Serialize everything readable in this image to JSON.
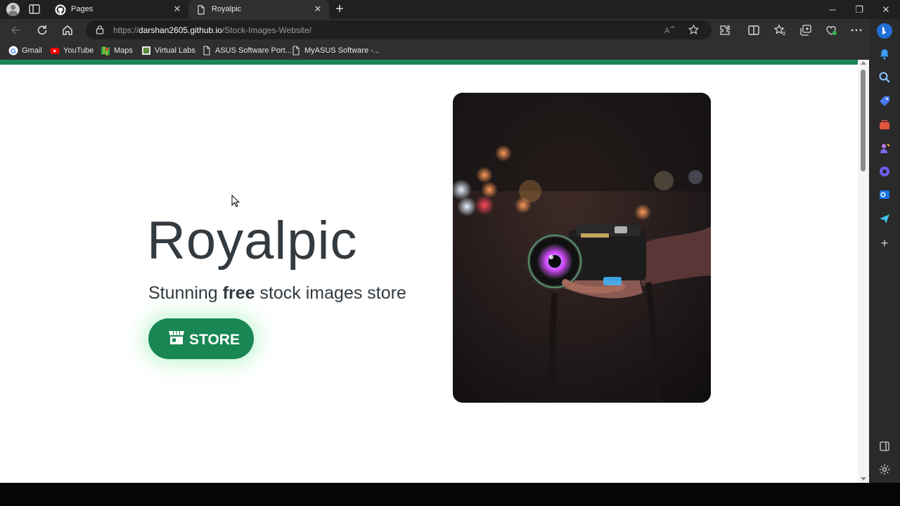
{
  "tabs": [
    {
      "title": "Pages",
      "favicon": "github-icon"
    },
    {
      "title": "Royalpic",
      "favicon": "page-icon",
      "active": true
    }
  ],
  "address": {
    "scheme": "https://",
    "host": "darshan2605.github.io",
    "path": "/Stock-Images-Website/"
  },
  "bookmarks": [
    {
      "label": "Gmail",
      "icon": "google-icon"
    },
    {
      "label": "YouTube",
      "icon": "youtube-icon"
    },
    {
      "label": "Maps",
      "icon": "maps-icon"
    },
    {
      "label": "Virtual Labs",
      "icon": "virtual-labs-icon"
    },
    {
      "label": "ASUS Software Port...",
      "icon": "page-icon"
    },
    {
      "label": "MyASUS Software -...",
      "icon": "page-icon"
    }
  ],
  "page": {
    "title": "Royalpic",
    "subtitle_before": "Stunning ",
    "subtitle_bold": "free",
    "subtitle_after": " stock images store",
    "store_button": "STORE",
    "hero_image": "camera-night-photo"
  },
  "colors": {
    "accent": "#198754",
    "heading": "#333a40",
    "browser_dark": "#202020"
  }
}
